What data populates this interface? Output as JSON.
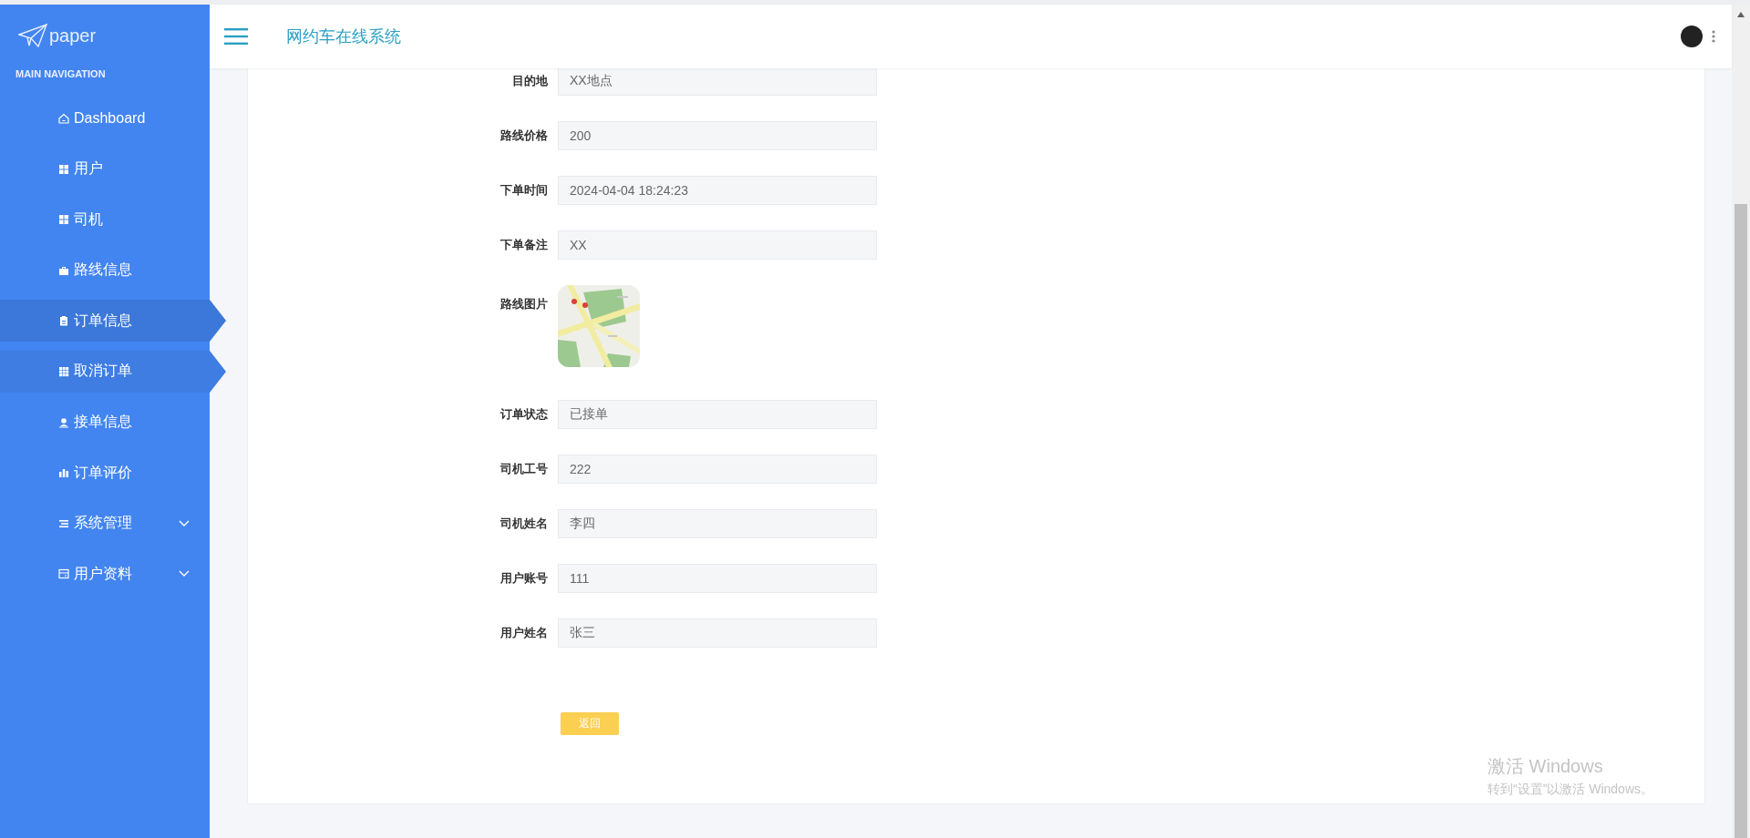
{
  "sidebar": {
    "logo": "paper",
    "section_title": "MAIN NAVIGATION",
    "items": [
      {
        "label": "Dashboard",
        "selected": false,
        "hovered": false
      },
      {
        "label": "用户",
        "selected": false,
        "hovered": false
      },
      {
        "label": "司机",
        "selected": false,
        "hovered": false
      },
      {
        "label": "路线信息",
        "selected": false,
        "hovered": false
      },
      {
        "label": "订单信息",
        "selected": true,
        "hovered": false
      },
      {
        "label": "取消订单",
        "selected": false,
        "hovered": true
      },
      {
        "label": "接单信息",
        "selected": false,
        "hovered": false
      },
      {
        "label": "订单评价",
        "selected": false,
        "hovered": false
      },
      {
        "label": "系统管理",
        "selected": false,
        "hovered": false,
        "expanded": false
      },
      {
        "label": "用户资料",
        "selected": false,
        "hovered": false,
        "expanded": false
      }
    ]
  },
  "header": {
    "title": "网约车在线系统"
  },
  "form": {
    "fields": [
      {
        "kind": "text",
        "label": "目的地",
        "value": "XX地点"
      },
      {
        "kind": "text",
        "label": "路线价格",
        "value": "200"
      },
      {
        "kind": "text",
        "label": "下单时间",
        "value": "2024-04-04 18:24:23"
      },
      {
        "kind": "text",
        "label": "下单备注",
        "value": "XX"
      },
      {
        "label": "路线图片"
      },
      {
        "kind": "text",
        "label": "订单状态",
        "value": "已接单"
      },
      {
        "kind": "text",
        "label": "司机工号",
        "value": "222"
      },
      {
        "kind": "text",
        "label": "司机姓名",
        "value": "李四"
      },
      {
        "kind": "text",
        "label": "用户账号",
        "value": "111"
      },
      {
        "kind": "text",
        "label": "用户姓名",
        "value": "张三"
      }
    ],
    "back_button": "返回"
  },
  "os_overlay": {
    "title": "激活 Windows",
    "subtitle": "转到“设置”以激活 Windows。"
  }
}
